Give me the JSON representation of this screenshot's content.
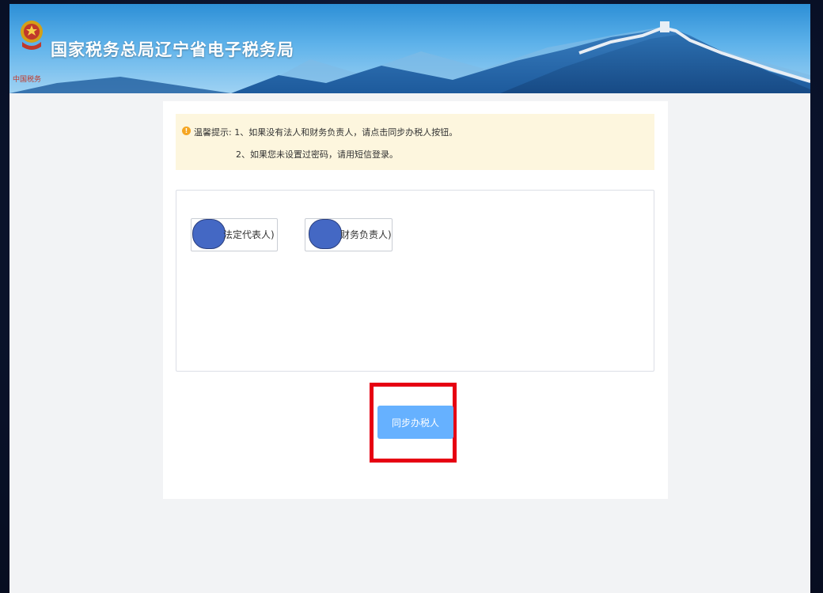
{
  "header": {
    "title": "国家税务总局辽宁省电子税务局",
    "emblem_icon": "tax-emblem-icon",
    "emblem_caption": "中国税务",
    "accent_color": "#3d95da"
  },
  "tip": {
    "icon": "info-circle-icon",
    "icon_glyph": "!",
    "line1": "温馨提示: 1、如果没有法人和财务负责人，请点击同步办税人按钮。",
    "line2": "2、如果您未设置过密码，请用短信登录。"
  },
  "persons": [
    {
      "label": "法定代表人)"
    },
    {
      "label": "财务负责人)"
    }
  ],
  "actions": {
    "sync_label": "同步办税人",
    "sync_color": "#66b1ff",
    "highlight_color": "#e60012"
  }
}
